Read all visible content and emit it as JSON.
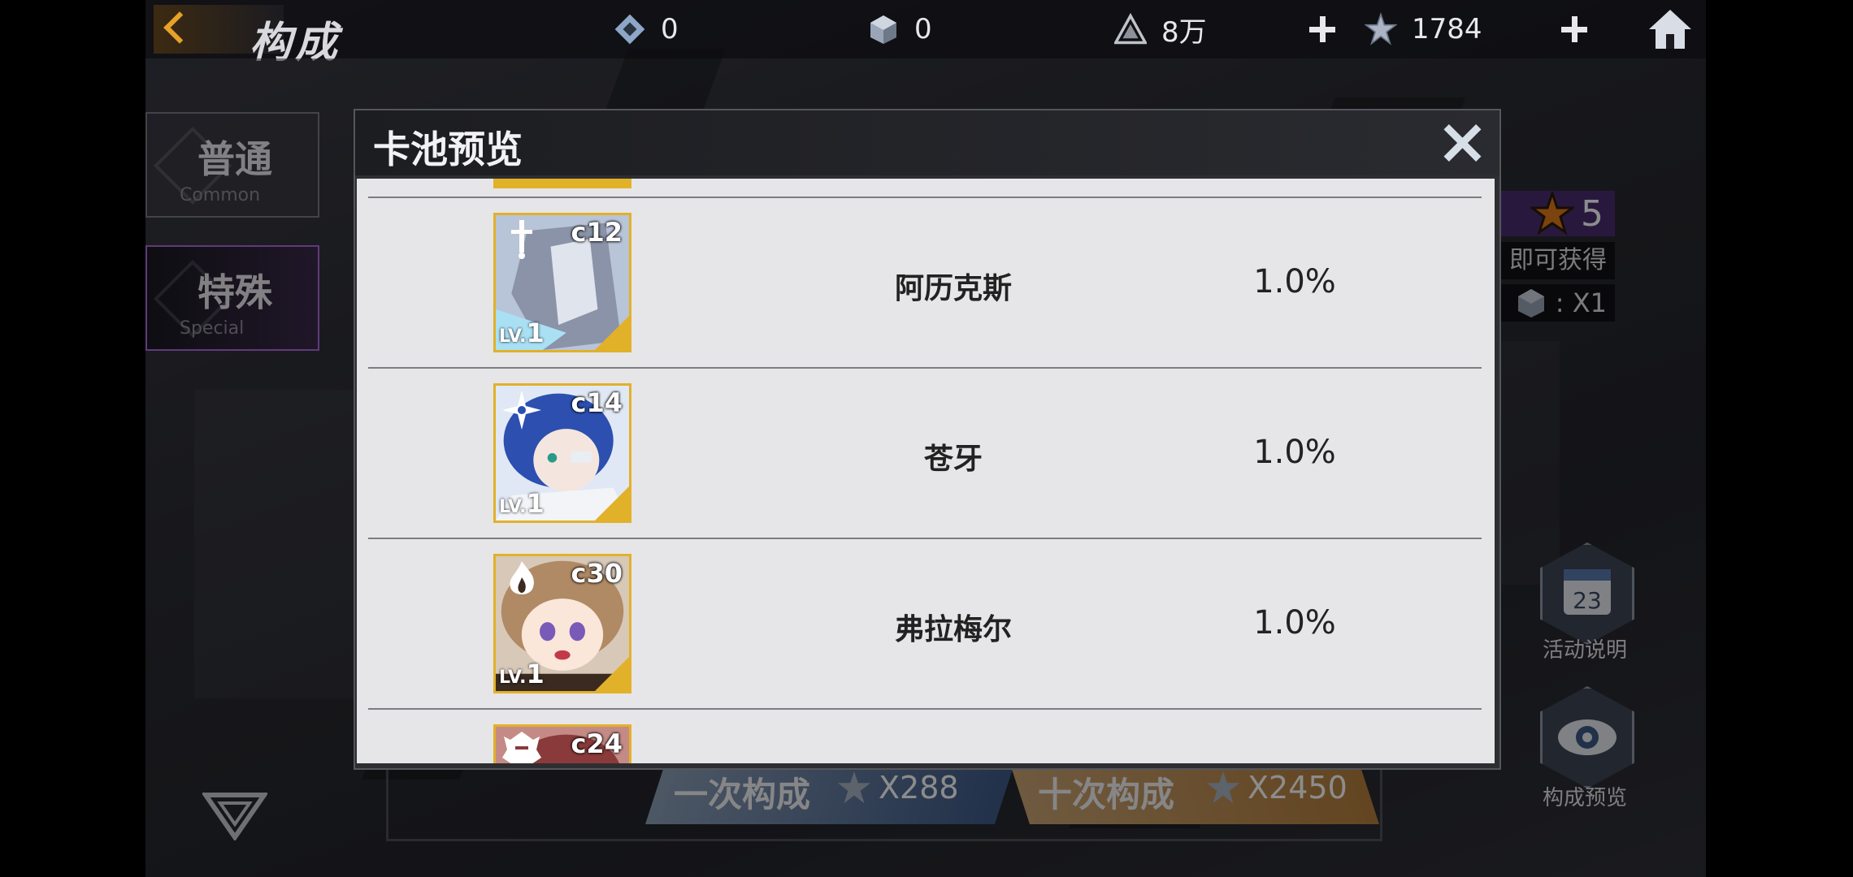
{
  "header": {
    "title": "构成",
    "resources": [
      {
        "icon": "chip-icon",
        "value": "0"
      },
      {
        "icon": "cube-icon",
        "value": "0"
      },
      {
        "icon": "alert-triangle-icon",
        "value": "8万"
      },
      {
        "icon": "star-crystal-icon",
        "value": "1784"
      }
    ]
  },
  "sidebar": {
    "tabs": [
      {
        "label": "普通",
        "sub": "Common"
      },
      {
        "label": "特殊",
        "sub": "Special"
      }
    ]
  },
  "banner": {
    "star_count": "5",
    "obtain_text": "即可获得",
    "reward_text": ":  X1"
  },
  "side_buttons": {
    "event_label": "活动说明",
    "calendar_day": "23",
    "preview_label": "构成预览"
  },
  "draw_buttons": {
    "single_label": "一次构成",
    "single_cost": "X288",
    "ten_label": "十次构成",
    "ten_cost": "X2450"
  },
  "modal": {
    "title": "卡池预览",
    "rows": [
      {
        "code": "c12",
        "name": "阿历克斯",
        "rate": "1.0%",
        "level_prefix": "LV.",
        "level": "1",
        "type_icon": "sword-icon"
      },
      {
        "code": "c14",
        "name": "苍牙",
        "rate": "1.0%",
        "level_prefix": "LV.",
        "level": "1",
        "type_icon": "shuriken-icon"
      },
      {
        "code": "c30",
        "name": "弗拉梅尔",
        "rate": "1.0%",
        "level_prefix": "LV.",
        "level": "1",
        "type_icon": "flame-icon"
      },
      {
        "code": "c24",
        "name": "",
        "rate": "",
        "level_prefix": "",
        "level": "",
        "type_icon": "crest-icon"
      }
    ]
  },
  "colors": {
    "accent_gold": "#e2b12a",
    "special_purple": "#b06ae0",
    "panel_bg": "#e6e6e8"
  }
}
